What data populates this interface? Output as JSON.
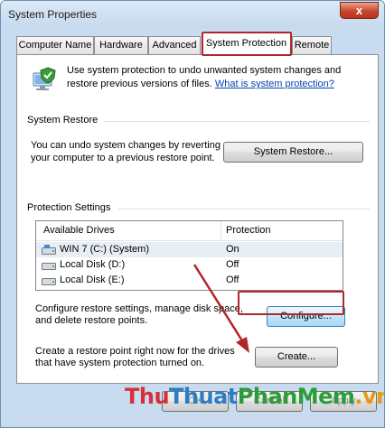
{
  "window": {
    "title": "System Properties",
    "close_glyph": "x"
  },
  "tabs": [
    {
      "label": "Computer Name"
    },
    {
      "label": "Hardware"
    },
    {
      "label": "Advanced"
    },
    {
      "label": "System Protection",
      "active": true
    },
    {
      "label": "Remote"
    }
  ],
  "intro": {
    "text": "Use system protection to undo unwanted system changes and restore previous versions of files.",
    "link": "What is system protection?"
  },
  "system_restore": {
    "heading": "System Restore",
    "description": "You can undo system changes by reverting your computer to a previous restore point.",
    "button": "System Restore..."
  },
  "protection_settings": {
    "heading": "Protection Settings",
    "columns": [
      "Available Drives",
      "Protection"
    ],
    "drives": [
      {
        "name": "WIN 7 (C:) (System)",
        "protection": "On",
        "icon": "system-drive-icon",
        "selected": true
      },
      {
        "name": "Local Disk (D:)",
        "protection": "Off",
        "icon": "drive-icon"
      },
      {
        "name": "Local Disk (E:)",
        "protection": "Off",
        "icon": "drive-icon"
      }
    ],
    "configure_text": "Configure restore settings, manage disk space, and delete restore points.",
    "configure_button": "Configure...",
    "create_text": "Create a restore point right now for the drives that have system protection turned on.",
    "create_button": "Create..."
  },
  "footer": {
    "buttons": [
      "OK",
      "Cancel",
      "Apply"
    ]
  },
  "watermark": {
    "part1": "Thu",
    "part2": "Thuat",
    "part3": "PhanMem",
    "part4": ".vn"
  },
  "colors": {
    "highlight": "#b0262c",
    "link": "#0645ad",
    "accent": "#3c7fb1"
  }
}
